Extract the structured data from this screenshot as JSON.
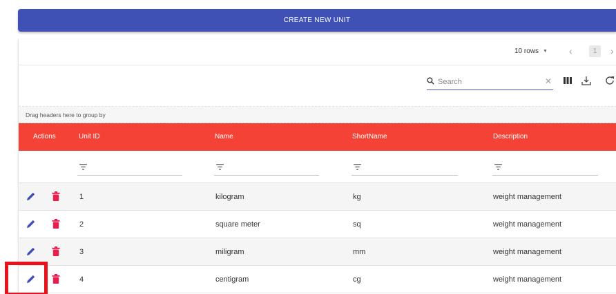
{
  "create_button": {
    "label": "CREATE NEW UNIT"
  },
  "pagination": {
    "rows_per_page": "10 rows",
    "current_page": "1"
  },
  "toolbar": {
    "search_placeholder": "Search",
    "search_value": ""
  },
  "grouping": {
    "hint": "Drag headers here to group by"
  },
  "table": {
    "columns": [
      "Actions",
      "Unit ID",
      "Name",
      "ShortName",
      "Description"
    ],
    "rows": [
      {
        "id": "1",
        "name": "kilogram",
        "short": "kg",
        "desc": "weight management"
      },
      {
        "id": "2",
        "name": "square meter",
        "short": "sq",
        "desc": "weight management"
      },
      {
        "id": "3",
        "name": "miligram",
        "short": "mm",
        "desc": "weight management"
      },
      {
        "id": "4",
        "name": "centigram",
        "short": "cg",
        "desc": "weight management"
      }
    ]
  },
  "colors": {
    "primary": "#3f51b5",
    "header_red": "#f44336",
    "delete_red": "#e91e4f",
    "highlight_red": "#e8121b"
  },
  "icons": [
    "search-icon",
    "clear-icon",
    "columns-icon",
    "download-icon",
    "refresh-icon",
    "filter-icon",
    "edit-icon",
    "delete-icon",
    "chevron-left-icon",
    "chevron-right-icon",
    "caret-down-icon"
  ]
}
